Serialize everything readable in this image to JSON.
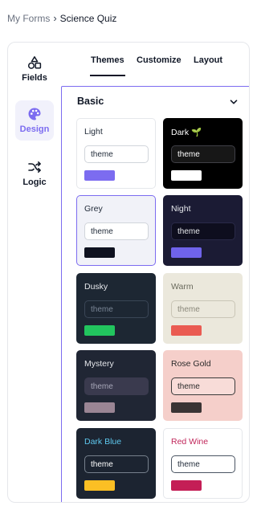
{
  "breadcrumb": {
    "parent": "My Forms",
    "separator": "›",
    "current": "Science Quiz"
  },
  "rail": {
    "items": [
      {
        "label": "Fields",
        "icon": "shapes-icon"
      },
      {
        "label": "Design",
        "icon": "palette-icon",
        "active": true
      },
      {
        "label": "Logic",
        "icon": "shuffle-icon"
      }
    ]
  },
  "tabs": [
    {
      "label": "Themes",
      "active": true
    },
    {
      "label": "Customize"
    },
    {
      "label": "Layout"
    }
  ],
  "section": {
    "title": "Basic",
    "icon": "chevron-down-icon"
  },
  "colors": {
    "accent": "#7c6cf0"
  },
  "themes": [
    {
      "name": "Light",
      "field": "theme",
      "bg": "#ffffff",
      "text": "#1f2937",
      "field_bg": "#ffffff",
      "field_border": "#d1d5db",
      "field_text": "#1f2937",
      "swatch": "#7c6cf0"
    },
    {
      "name": "Dark 🌱",
      "field": "theme",
      "bg": "#000000",
      "text": "#ffffff",
      "field_bg": "#171717",
      "field_border": "#3f3f46",
      "field_text": "#ffffff",
      "swatch": "#ffffff"
    },
    {
      "name": "Grey",
      "field": "theme",
      "bg": "#f1f2f8",
      "text": "#1f2937",
      "field_bg": "#ffffff",
      "field_border": "#d1d5db",
      "field_text": "#1f2937",
      "swatch": "#0f1220",
      "selected": true
    },
    {
      "name": "Night",
      "field": "theme",
      "bg": "#1b1b34",
      "text": "#e5e7eb",
      "field_bg": "#0e0e1e",
      "field_border": "#2a2a48",
      "field_text": "#e5e7eb",
      "swatch": "#6f63ea"
    },
    {
      "name": "Dusky",
      "field": "theme",
      "bg": "#1d2733",
      "text": "#e5e7eb",
      "field_bg": "#1d2733",
      "field_border": "#3a4656",
      "field_text": "#7a8696",
      "swatch": "#22c55e"
    },
    {
      "name": "Warm",
      "field": "theme",
      "bg": "#ebe8dc",
      "text": "#6b6b5e",
      "field_bg": "#ebe8dc",
      "field_border": "#c9c5b6",
      "field_text": "#8a877a",
      "swatch": "#ea5b52"
    },
    {
      "name": "Mystery",
      "field": "theme",
      "bg": "#202634",
      "text": "#e5e7eb",
      "field_bg": "#3a3a4e",
      "field_border": "#3a3a4e",
      "field_text": "#a7a7b8",
      "swatch": "#9a8594"
    },
    {
      "name": "Rose Gold",
      "field": "theme",
      "bg": "#f5cfca",
      "text": "#2b2b2b",
      "field_bg": "#f8dcd8",
      "field_border": "#3a3a3a",
      "field_text": "#2b2b2b",
      "swatch": "#3a3434"
    },
    {
      "name": "Dark Blue",
      "field": "theme",
      "bg": "#1c2431",
      "text": "#5ec8ee",
      "field_bg": "#1c2431",
      "field_border": "#76808c",
      "field_text": "#ffffff",
      "swatch": "#fbbf24"
    },
    {
      "name": "Red Wine",
      "field": "theme",
      "bg": "#ffffff",
      "text": "#c0265a",
      "field_bg": "#ffffff",
      "field_border": "#4b5563",
      "field_text": "#1f2937",
      "swatch": "#c41e56"
    }
  ]
}
